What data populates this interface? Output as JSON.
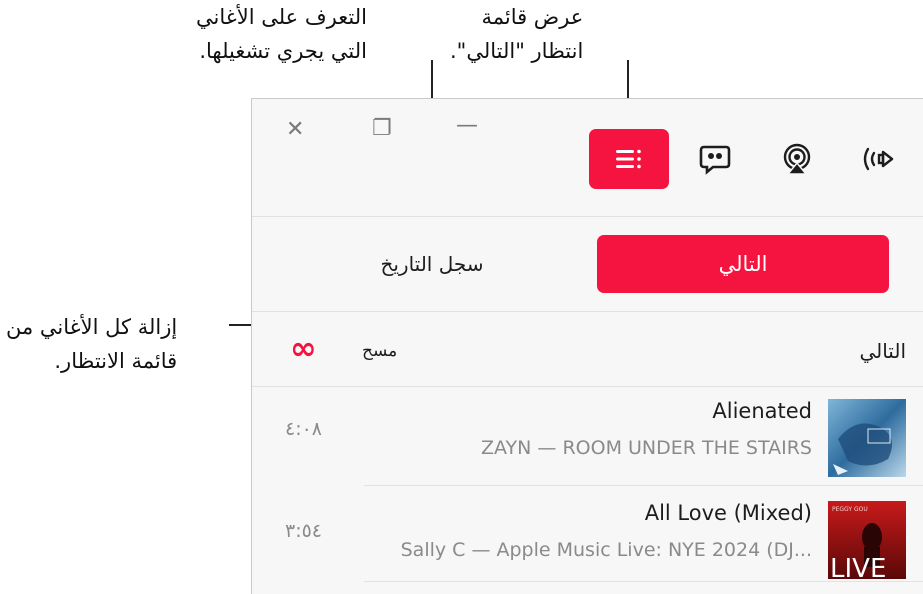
{
  "callouts": {
    "learn_line1": "التعرف على الأغاني",
    "learn_line2": "التي يجري تشغيلها.",
    "queue_line1": "عرض قائمة",
    "queue_line2": "انتظار \"التالي\".",
    "clear_line1": "إزالة كل الأغاني من",
    "clear_line2": "قائمة الانتظار."
  },
  "window_controls": {
    "close": "✕",
    "restore": "❐",
    "minimize": "—"
  },
  "tabs": {
    "next": "التالي",
    "history": "سجل التاريخ"
  },
  "section": {
    "title": "التالي",
    "clear": "مسح",
    "clear_icon": "∞"
  },
  "tracks": [
    {
      "title": "Alienated",
      "subtitle": "ZAYN — ROOM UNDER THE STAIRS",
      "duration": "٤:٠٨"
    },
    {
      "title": "All Love (Mixed)",
      "subtitle": "Sally C — Apple Music Live: NYE 2024 (DJ...",
      "duration": "٣:٥٤",
      "art_text": "LIVE",
      "art_small": "PEGGY GOU"
    }
  ],
  "colors": {
    "accent": "#f5143f",
    "muted": "#8a8a8a"
  }
}
